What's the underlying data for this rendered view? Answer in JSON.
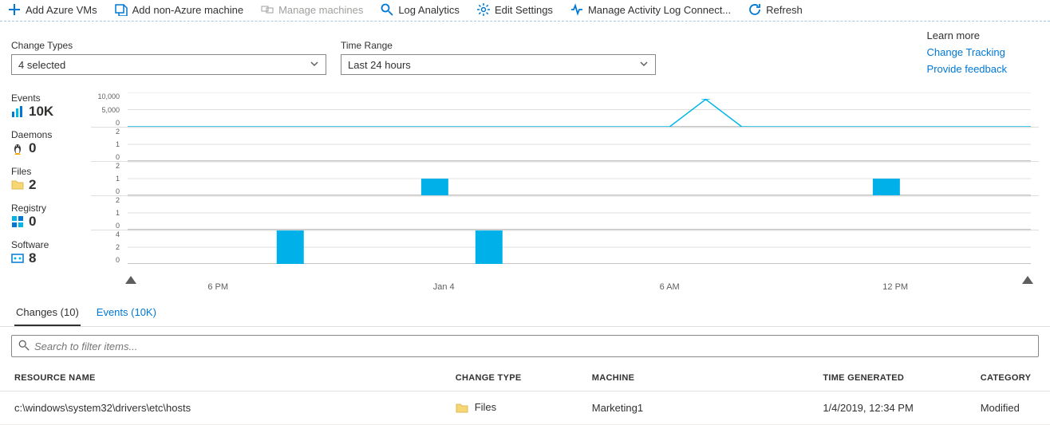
{
  "toolbar": {
    "add_vms": "Add Azure VMs",
    "add_non_azure": "Add non-Azure machine",
    "manage_machines": "Manage machines",
    "log_analytics": "Log Analytics",
    "edit_settings": "Edit Settings",
    "manage_activity": "Manage Activity Log Connect...",
    "refresh": "Refresh"
  },
  "filters": {
    "change_types_label": "Change Types",
    "change_types_value": "4 selected",
    "time_range_label": "Time Range",
    "time_range_value": "Last 24 hours"
  },
  "learn_more": {
    "label": "Learn more",
    "link1": "Change Tracking",
    "link2": "Provide feedback"
  },
  "stats": {
    "events": {
      "label": "Events",
      "value": "10K"
    },
    "daemons": {
      "label": "Daemons",
      "value": "0"
    },
    "files": {
      "label": "Files",
      "value": "2"
    },
    "registry": {
      "label": "Registry",
      "value": "0"
    },
    "software": {
      "label": "Software",
      "value": "8"
    }
  },
  "chart_data": [
    {
      "name": "events",
      "type": "line",
      "ylim": [
        0,
        10000
      ],
      "yticks": [
        "10,000",
        "5,000",
        "0"
      ],
      "x": [
        0,
        4,
        8,
        12,
        16,
        20,
        24,
        28,
        32,
        36,
        40,
        44,
        48,
        52,
        56,
        60,
        64,
        68,
        72,
        76,
        80,
        84,
        88,
        92,
        96,
        100
      ],
      "y": [
        0,
        0,
        0,
        0,
        0,
        0,
        0,
        0,
        0,
        0,
        0,
        0,
        0,
        0,
        0,
        0,
        8000,
        0,
        0,
        0,
        0,
        0,
        0,
        0,
        0,
        0
      ]
    },
    {
      "name": "daemons",
      "type": "bar",
      "ylim": [
        0,
        2
      ],
      "yticks": [
        "2",
        "1",
        "0"
      ],
      "bars": []
    },
    {
      "name": "files",
      "type": "bar",
      "ylim": [
        0,
        2
      ],
      "yticks": [
        "2",
        "1",
        "0"
      ],
      "bars": [
        {
          "x": 34,
          "h": 1
        },
        {
          "x": 84,
          "h": 1
        }
      ]
    },
    {
      "name": "registry",
      "type": "bar",
      "ylim": [
        0,
        2
      ],
      "yticks": [
        "2",
        "1",
        "0"
      ],
      "bars": []
    },
    {
      "name": "software",
      "type": "bar",
      "ylim": [
        0,
        4
      ],
      "yticks": [
        "4",
        "2",
        "0"
      ],
      "bars": [
        {
          "x": 18,
          "h": 4
        },
        {
          "x": 40,
          "h": 4
        }
      ]
    }
  ],
  "xaxis": {
    "labels": [
      {
        "pos": 10,
        "text": "6 PM"
      },
      {
        "pos": 35,
        "text": "Jan 4"
      },
      {
        "pos": 60,
        "text": "6 AM"
      },
      {
        "pos": 85,
        "text": "12 PM"
      }
    ]
  },
  "tabs": {
    "changes": "Changes (10)",
    "events": "Events (10K)"
  },
  "search": {
    "placeholder": "Search to filter items..."
  },
  "table": {
    "headers": {
      "resource": "RESOURCE NAME",
      "change_type": "CHANGE TYPE",
      "machine": "MACHINE",
      "time": "TIME GENERATED",
      "category": "CATEGORY"
    },
    "rows": [
      {
        "resource": "c:\\windows\\system32\\drivers\\etc\\hosts",
        "change_type": "Files",
        "machine": "Marketing1",
        "time": "1/4/2019, 12:34 PM",
        "category": "Modified"
      }
    ]
  }
}
